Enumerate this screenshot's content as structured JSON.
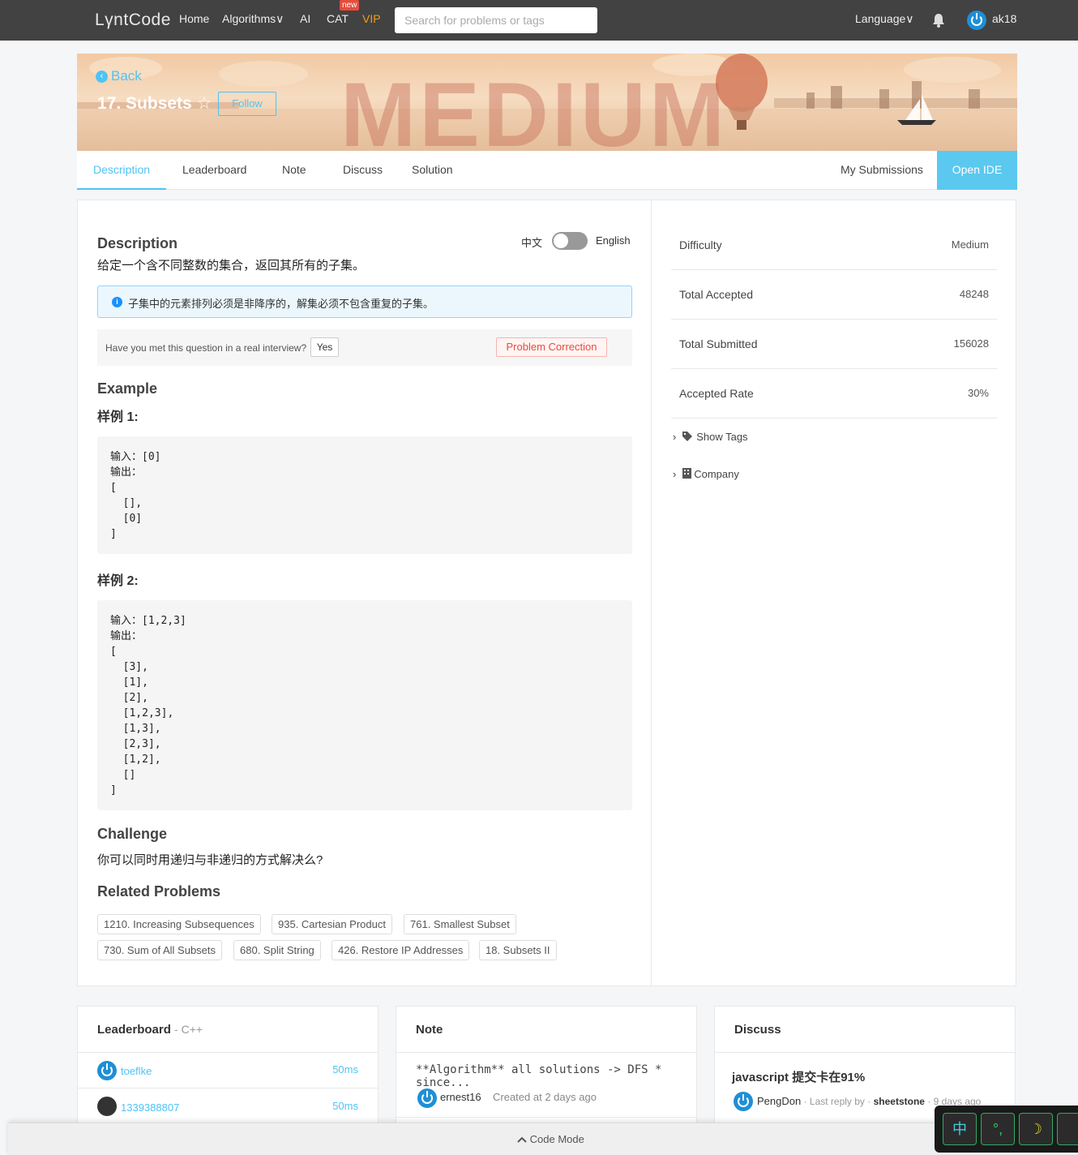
{
  "nav": {
    "logo": "LγntCode",
    "home": "Home",
    "algorithms": "Algorithms",
    "ai": "AI",
    "cat": "CAT",
    "new_badge": "new",
    "vip": "VIP",
    "search_placeholder": "Search for problems or tags",
    "language": "Language",
    "username": "ak18",
    "chevron": "∨"
  },
  "banner": {
    "back": "Back",
    "title": "17. Subsets",
    "star": "☆",
    "follow": "Follow",
    "difficulty_word": "MEDIUM"
  },
  "tabs": {
    "description": "Description",
    "leaderboard": "Leaderboard",
    "note": "Note",
    "discuss": "Discuss",
    "solution": "Solution",
    "my_submissions": "My Submissions",
    "open_ide": "Open IDE"
  },
  "description": {
    "heading": "Description",
    "lang_zh": "中文",
    "lang_en": "English",
    "text": "给定一个含不同整数的集合，返回其所有的子集。",
    "note": "子集中的元素排列必须是非降序的，解集必须不包含重复的子集。",
    "interview_question": "Have you met this question in a real interview?",
    "yes": "Yes",
    "problem_correction": "Problem Correction"
  },
  "example": {
    "heading": "Example",
    "sample1_title": "样例 1:",
    "sample1_code": "输入：[0]\n输出：\n[\n  [],\n  [0]\n]",
    "sample2_title": "样例 2:",
    "sample2_code": "输入：[1,2,3]\n输出：\n[\n  [3],\n  [1],\n  [2],\n  [1,2,3],\n  [1,3],\n  [2,3],\n  [1,2],\n  []\n]"
  },
  "challenge": {
    "heading": "Challenge",
    "text": "你可以同时用递归与非递归的方式解决么?"
  },
  "related": {
    "heading": "Related Problems",
    "tags": [
      "1210. Increasing Subsequences",
      "935. Cartesian Product",
      "761. Smallest Subset",
      "730. Sum of All Subsets",
      "680. Split String",
      "426. Restore IP Addresses",
      "18. Subsets II"
    ]
  },
  "stats": {
    "difficulty_label": "Difficulty",
    "difficulty_value": "Medium",
    "accepted_label": "Total Accepted",
    "accepted_value": "48248",
    "submitted_label": "Total Submitted",
    "submitted_value": "156028",
    "rate_label": "Accepted Rate",
    "rate_value": "30%",
    "show_tags": "Show Tags",
    "company": "Company"
  },
  "leaderboard_card": {
    "heading": "Leaderboard",
    "lang": "- C++",
    "rows": [
      {
        "user": "toeflke",
        "time": "50ms"
      },
      {
        "user": "1339388807",
        "time": "50ms"
      }
    ]
  },
  "note_card": {
    "heading": "Note",
    "title": "**Algorithm** all solutions -> DFS * since...",
    "author": "ernest16",
    "meta": "Created at 2 days ago"
  },
  "discuss_card": {
    "heading": "Discuss",
    "title": "javascript 提交卡在91%",
    "author": "PengDon",
    "meta_prefix": "· Last reply by ·",
    "reply_user": "sheetstone",
    "meta_suffix": "· 9 days ago"
  },
  "codemode": {
    "label": "Code Mode"
  },
  "ime": {
    "k1": "中",
    "k2": "°,",
    "k3": "☽"
  }
}
